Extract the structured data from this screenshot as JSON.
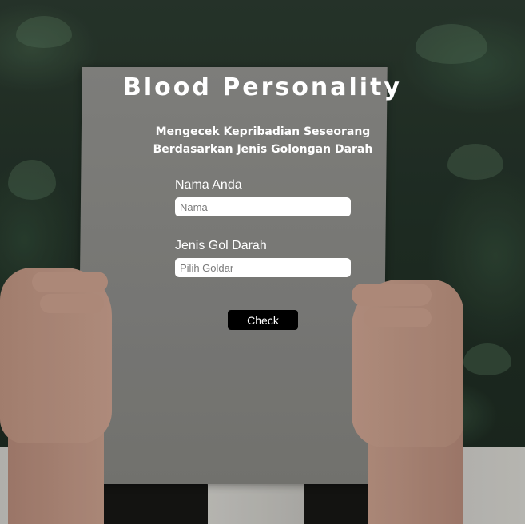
{
  "header": {
    "title": "Blood Personality",
    "subtitle_line1": "Mengecek Kepribadian Seseorang",
    "subtitle_line2": "Berdasarkan Jenis Golongan Darah"
  },
  "form": {
    "name_label": "Nama Anda",
    "name_placeholder": "Nama",
    "name_value": "",
    "blood_label": "Jenis Gol Darah",
    "blood_placeholder": "Pilih Goldar",
    "blood_value": "",
    "submit_label": "Check"
  },
  "colors": {
    "text": "#ffffff",
    "button_bg": "#000000",
    "input_bg": "#ffffff",
    "paper": "#8a8a86"
  }
}
